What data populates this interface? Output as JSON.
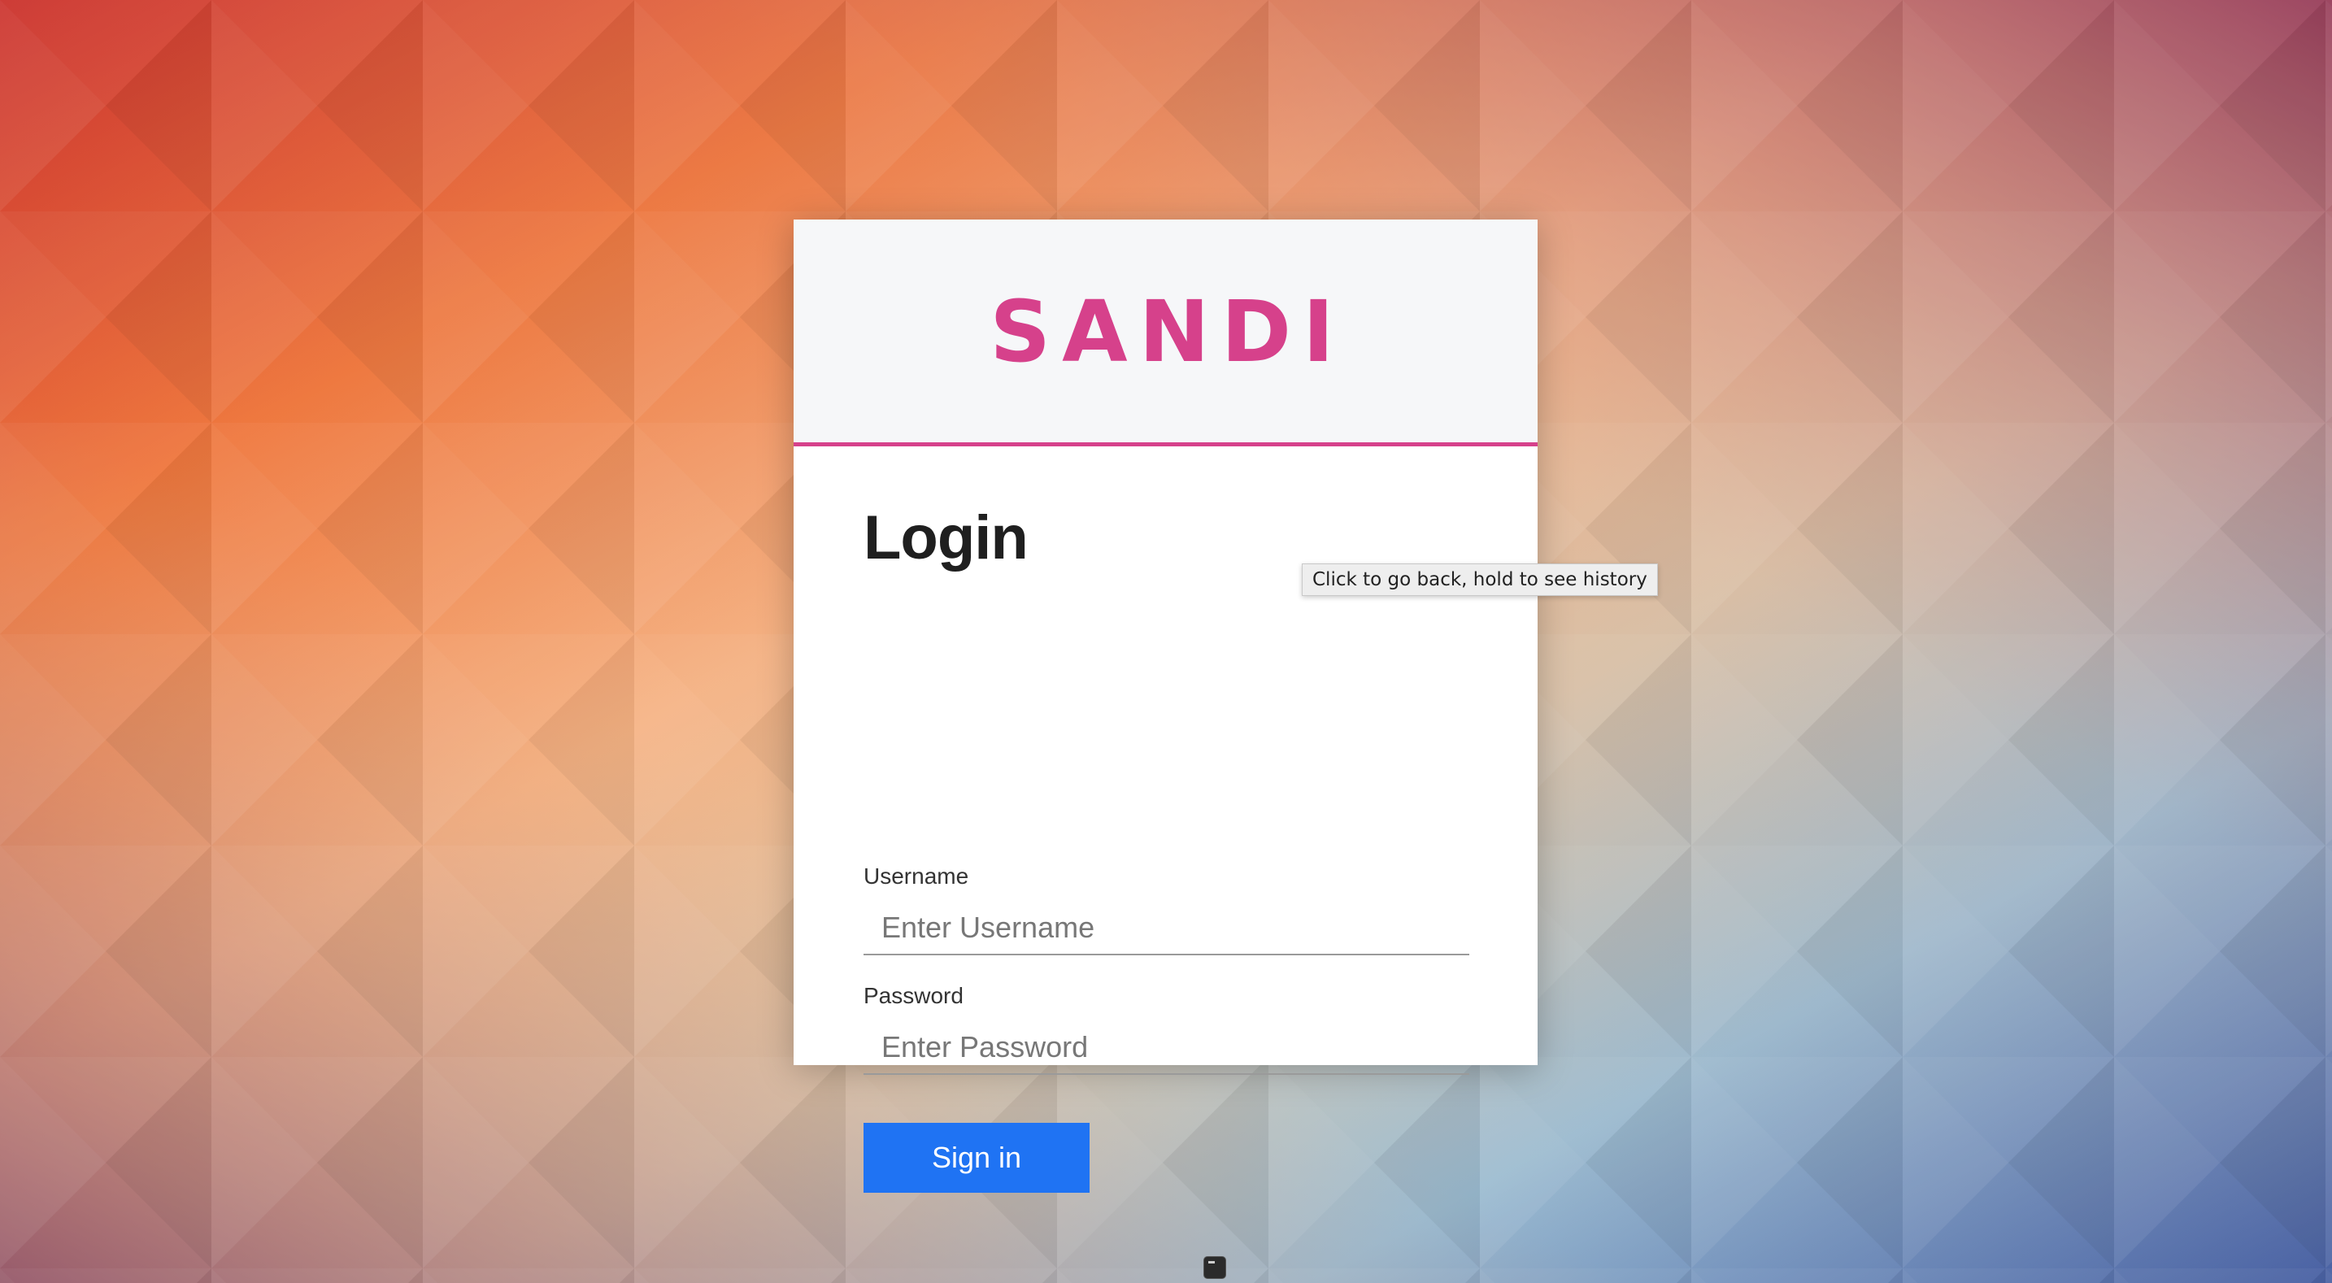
{
  "brand": {
    "logo_text": "SANDI",
    "accent_color": "#d6418b"
  },
  "login": {
    "title": "Login",
    "username_label": "Username",
    "username_placeholder": "Enter Username",
    "username_value": "",
    "password_label": "Password",
    "password_placeholder": "Enter Password",
    "password_value": "",
    "signin_label": "Sign in",
    "signin_color": "#1f73f3"
  },
  "tooltip": {
    "text": "Click to go back, hold to see history"
  },
  "dock": {
    "icon": "terminal-icon"
  }
}
